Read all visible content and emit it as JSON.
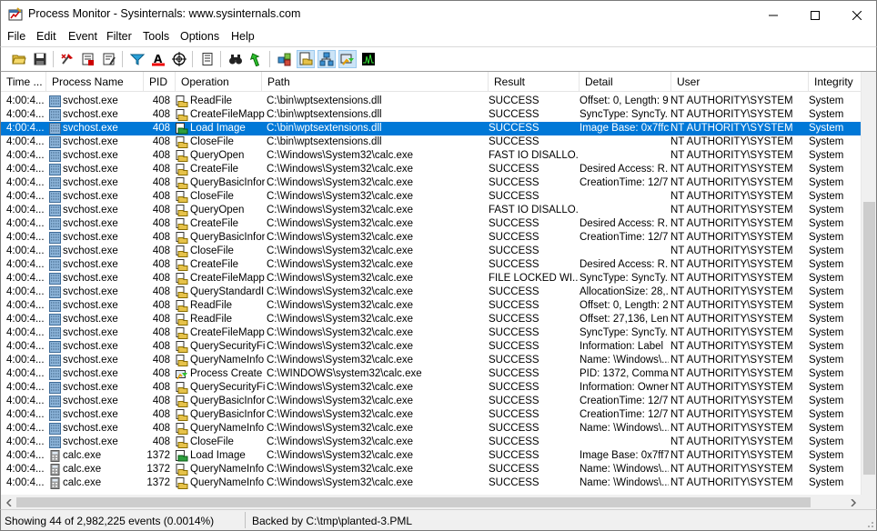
{
  "window": {
    "title": "Process Monitor - Sysinternals: www.sysinternals.com"
  },
  "menu": [
    "File",
    "Edit",
    "Event",
    "Filter",
    "Tools",
    "Options",
    "Help"
  ],
  "toolbar": {
    "buttons": [
      "open-icon",
      "save-icon",
      "capture-icon",
      "autoscroll-icon",
      "clear-icon",
      "filter-icon",
      "highlight-icon",
      "include-process-icon",
      "process-tree-icon",
      "find-icon",
      "jump-icon",
      "registry-activity-icon",
      "file-activity-icon",
      "network-activity-icon",
      "process-thread-activity-icon",
      "profiling-events-icon"
    ],
    "pressed": [
      "file-activity-icon",
      "network-activity-icon",
      "process-thread-activity-icon"
    ]
  },
  "columns": [
    "Time ...",
    "Process Name",
    "PID",
    "Operation",
    "Path",
    "Result",
    "Detail",
    "User",
    "Integrity"
  ],
  "rows": [
    {
      "time": "4:00:4...",
      "process": "svchost.exe",
      "pid": "408",
      "operation": "ReadFile",
      "op_kind": "file",
      "path": "C:\\bin\\wptsextensions.dll",
      "result": "SUCCESS",
      "detail": "Offset: 0, Length: 9...",
      "user": "NT AUTHORITY\\SYSTEM",
      "integrity": "System"
    },
    {
      "time": "4:00:4...",
      "process": "svchost.exe",
      "pid": "408",
      "operation": "CreateFileMapp...",
      "op_kind": "file",
      "path": "C:\\bin\\wptsextensions.dll",
      "result": "SUCCESS",
      "detail": "SyncType: SyncTy...",
      "user": "NT AUTHORITY\\SYSTEM",
      "integrity": "System"
    },
    {
      "time": "4:00:4...",
      "process": "svchost.exe",
      "pid": "408",
      "operation": "Load Image",
      "op_kind": "image",
      "path": "C:\\bin\\wptsextensions.dll",
      "result": "SUCCESS",
      "detail": "Image Base: 0x7ffc...",
      "user": "NT AUTHORITY\\SYSTEM",
      "integrity": "System",
      "selected": true
    },
    {
      "time": "4:00:4...",
      "process": "svchost.exe",
      "pid": "408",
      "operation": "CloseFile",
      "op_kind": "file",
      "path": "C:\\bin\\wptsextensions.dll",
      "result": "SUCCESS",
      "detail": "",
      "user": "NT AUTHORITY\\SYSTEM",
      "integrity": "System"
    },
    {
      "time": "4:00:4...",
      "process": "svchost.exe",
      "pid": "408",
      "operation": "QueryOpen",
      "op_kind": "file",
      "path": "C:\\Windows\\System32\\calc.exe",
      "result": "FAST IO DISALLO...",
      "detail": "",
      "user": "NT AUTHORITY\\SYSTEM",
      "integrity": "System"
    },
    {
      "time": "4:00:4...",
      "process": "svchost.exe",
      "pid": "408",
      "operation": "CreateFile",
      "op_kind": "file",
      "path": "C:\\Windows\\System32\\calc.exe",
      "result": "SUCCESS",
      "detail": "Desired Access: R...",
      "user": "NT AUTHORITY\\SYSTEM",
      "integrity": "System"
    },
    {
      "time": "4:00:4...",
      "process": "svchost.exe",
      "pid": "408",
      "operation": "QueryBasicInfor...",
      "op_kind": "file",
      "path": "C:\\Windows\\System32\\calc.exe",
      "result": "SUCCESS",
      "detail": "CreationTime: 12/7...",
      "user": "NT AUTHORITY\\SYSTEM",
      "integrity": "System"
    },
    {
      "time": "4:00:4...",
      "process": "svchost.exe",
      "pid": "408",
      "operation": "CloseFile",
      "op_kind": "file",
      "path": "C:\\Windows\\System32\\calc.exe",
      "result": "SUCCESS",
      "detail": "",
      "user": "NT AUTHORITY\\SYSTEM",
      "integrity": "System"
    },
    {
      "time": "4:00:4...",
      "process": "svchost.exe",
      "pid": "408",
      "operation": "QueryOpen",
      "op_kind": "file",
      "path": "C:\\Windows\\System32\\calc.exe",
      "result": "FAST IO DISALLO...",
      "detail": "",
      "user": "NT AUTHORITY\\SYSTEM",
      "integrity": "System"
    },
    {
      "time": "4:00:4...",
      "process": "svchost.exe",
      "pid": "408",
      "operation": "CreateFile",
      "op_kind": "file",
      "path": "C:\\Windows\\System32\\calc.exe",
      "result": "SUCCESS",
      "detail": "Desired Access: R...",
      "user": "NT AUTHORITY\\SYSTEM",
      "integrity": "System"
    },
    {
      "time": "4:00:4...",
      "process": "svchost.exe",
      "pid": "408",
      "operation": "QueryBasicInfor...",
      "op_kind": "file",
      "path": "C:\\Windows\\System32\\calc.exe",
      "result": "SUCCESS",
      "detail": "CreationTime: 12/7...",
      "user": "NT AUTHORITY\\SYSTEM",
      "integrity": "System"
    },
    {
      "time": "4:00:4...",
      "process": "svchost.exe",
      "pid": "408",
      "operation": "CloseFile",
      "op_kind": "file",
      "path": "C:\\Windows\\System32\\calc.exe",
      "result": "SUCCESS",
      "detail": "",
      "user": "NT AUTHORITY\\SYSTEM",
      "integrity": "System"
    },
    {
      "time": "4:00:4...",
      "process": "svchost.exe",
      "pid": "408",
      "operation": "CreateFile",
      "op_kind": "file",
      "path": "C:\\Windows\\System32\\calc.exe",
      "result": "SUCCESS",
      "detail": "Desired Access: R...",
      "user": "NT AUTHORITY\\SYSTEM",
      "integrity": "System"
    },
    {
      "time": "4:00:4...",
      "process": "svchost.exe",
      "pid": "408",
      "operation": "CreateFileMapp...",
      "op_kind": "file",
      "path": "C:\\Windows\\System32\\calc.exe",
      "result": "FILE LOCKED WI...",
      "detail": "SyncType: SyncTy...",
      "user": "NT AUTHORITY\\SYSTEM",
      "integrity": "System"
    },
    {
      "time": "4:00:4...",
      "process": "svchost.exe",
      "pid": "408",
      "operation": "QueryStandardI...",
      "op_kind": "file",
      "path": "C:\\Windows\\System32\\calc.exe",
      "result": "SUCCESS",
      "detail": "AllocationSize: 28,...",
      "user": "NT AUTHORITY\\SYSTEM",
      "integrity": "System"
    },
    {
      "time": "4:00:4...",
      "process": "svchost.exe",
      "pid": "408",
      "operation": "ReadFile",
      "op_kind": "file",
      "path": "C:\\Windows\\System32\\calc.exe",
      "result": "SUCCESS",
      "detail": "Offset: 0, Length: 2...",
      "user": "NT AUTHORITY\\SYSTEM",
      "integrity": "System"
    },
    {
      "time": "4:00:4...",
      "process": "svchost.exe",
      "pid": "408",
      "operation": "ReadFile",
      "op_kind": "file",
      "path": "C:\\Windows\\System32\\calc.exe",
      "result": "SUCCESS",
      "detail": "Offset: 27,136, Len...",
      "user": "NT AUTHORITY\\SYSTEM",
      "integrity": "System"
    },
    {
      "time": "4:00:4...",
      "process": "svchost.exe",
      "pid": "408",
      "operation": "CreateFileMapp...",
      "op_kind": "file",
      "path": "C:\\Windows\\System32\\calc.exe",
      "result": "SUCCESS",
      "detail": "SyncType: SyncTy...",
      "user": "NT AUTHORITY\\SYSTEM",
      "integrity": "System"
    },
    {
      "time": "4:00:4...",
      "process": "svchost.exe",
      "pid": "408",
      "operation": "QuerySecurityFile",
      "op_kind": "file",
      "path": "C:\\Windows\\System32\\calc.exe",
      "result": "SUCCESS",
      "detail": "Information: Label",
      "user": "NT AUTHORITY\\SYSTEM",
      "integrity": "System"
    },
    {
      "time": "4:00:4...",
      "process": "svchost.exe",
      "pid": "408",
      "operation": "QueryNameInfo...",
      "op_kind": "file",
      "path": "C:\\Windows\\System32\\calc.exe",
      "result": "SUCCESS",
      "detail": "Name: \\Windows\\...",
      "user": "NT AUTHORITY\\SYSTEM",
      "integrity": "System"
    },
    {
      "time": "4:00:4...",
      "process": "svchost.exe",
      "pid": "408",
      "operation": "Process Create",
      "op_kind": "process",
      "path": "C:\\WINDOWS\\system32\\calc.exe",
      "result": "SUCCESS",
      "detail": "PID: 1372, Comma...",
      "user": "NT AUTHORITY\\SYSTEM",
      "integrity": "System"
    },
    {
      "time": "4:00:4...",
      "process": "svchost.exe",
      "pid": "408",
      "operation": "QuerySecurityFile",
      "op_kind": "file",
      "path": "C:\\Windows\\System32\\calc.exe",
      "result": "SUCCESS",
      "detail": "Information: Owner...",
      "user": "NT AUTHORITY\\SYSTEM",
      "integrity": "System"
    },
    {
      "time": "4:00:4...",
      "process": "svchost.exe",
      "pid": "408",
      "operation": "QueryBasicInfor...",
      "op_kind": "file",
      "path": "C:\\Windows\\System32\\calc.exe",
      "result": "SUCCESS",
      "detail": "CreationTime: 12/7...",
      "user": "NT AUTHORITY\\SYSTEM",
      "integrity": "System"
    },
    {
      "time": "4:00:4...",
      "process": "svchost.exe",
      "pid": "408",
      "operation": "QueryBasicInfor...",
      "op_kind": "file",
      "path": "C:\\Windows\\System32\\calc.exe",
      "result": "SUCCESS",
      "detail": "CreationTime: 12/7...",
      "user": "NT AUTHORITY\\SYSTEM",
      "integrity": "System"
    },
    {
      "time": "4:00:4...",
      "process": "svchost.exe",
      "pid": "408",
      "operation": "QueryNameInfo...",
      "op_kind": "file",
      "path": "C:\\Windows\\System32\\calc.exe",
      "result": "SUCCESS",
      "detail": "Name: \\Windows\\...",
      "user": "NT AUTHORITY\\SYSTEM",
      "integrity": "System"
    },
    {
      "time": "4:00:4...",
      "process": "svchost.exe",
      "pid": "408",
      "operation": "CloseFile",
      "op_kind": "file",
      "path": "C:\\Windows\\System32\\calc.exe",
      "result": "SUCCESS",
      "detail": "",
      "user": "NT AUTHORITY\\SYSTEM",
      "integrity": "System"
    },
    {
      "time": "4:00:4...",
      "process": "calc.exe",
      "pid": "1372",
      "operation": "Load Image",
      "op_kind": "image",
      "path": "C:\\Windows\\System32\\calc.exe",
      "result": "SUCCESS",
      "detail": "Image Base: 0x7ff7...",
      "user": "NT AUTHORITY\\SYSTEM",
      "integrity": "System"
    },
    {
      "time": "4:00:4...",
      "process": "calc.exe",
      "pid": "1372",
      "operation": "QueryNameInfo...",
      "op_kind": "file",
      "path": "C:\\Windows\\System32\\calc.exe",
      "result": "SUCCESS",
      "detail": "Name: \\Windows\\...",
      "user": "NT AUTHORITY\\SYSTEM",
      "integrity": "System"
    },
    {
      "time": "4:00:4...",
      "process": "calc.exe",
      "pid": "1372",
      "operation": "QueryNameInfo...",
      "op_kind": "file",
      "path": "C:\\Windows\\System32\\calc.exe",
      "result": "SUCCESS",
      "detail": "Name: \\Windows\\...",
      "user": "NT AUTHORITY\\SYSTEM",
      "integrity": "System"
    }
  ],
  "status": {
    "events": "Showing 44 of 2,982,225 events (0.0014%)",
    "backing": "Backed by C:\\tmp\\planted-3.PML"
  },
  "colors": {
    "selection": "#0078d7",
    "file_icon": "#2e7d32",
    "process_icon": "#e6a000"
  }
}
